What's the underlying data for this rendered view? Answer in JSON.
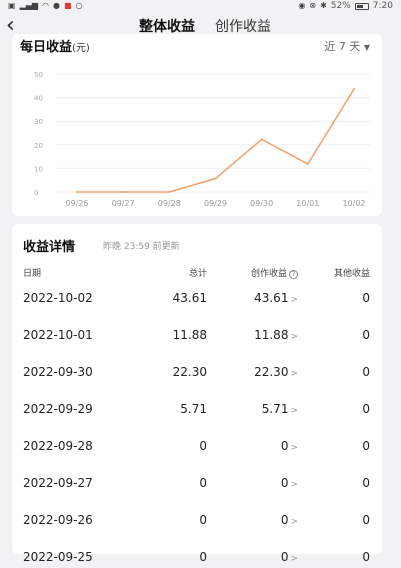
{
  "status_bar": {
    "battery_percent": "52%",
    "time": "7:20"
  },
  "header": {
    "tabs": [
      {
        "label": "整体收益",
        "active": true
      },
      {
        "label": "创作收益",
        "active": false
      }
    ]
  },
  "daily_card": {
    "title": "每日收益",
    "unit": "(元)",
    "range_label": "近 7 天"
  },
  "chart_data": {
    "type": "line",
    "categories": [
      "09/26",
      "09/27",
      "09/28",
      "09/29",
      "09/30",
      "10/01",
      "10/02"
    ],
    "values": [
      0,
      0,
      0,
      5.71,
      22.3,
      11.88,
      43.61
    ],
    "y_ticks": [
      0,
      10,
      20,
      30,
      40,
      50
    ],
    "ylim": [
      0,
      50
    ],
    "grid": true,
    "color": "#f0a26a"
  },
  "detail_card": {
    "title": "收益详情",
    "update_note": "昨晚 23:59 前更新",
    "columns": {
      "date": "日期",
      "total": "总计",
      "creation": "创作收益",
      "other": "其他收益"
    },
    "rows": [
      {
        "date": "2022-10-02",
        "total": "43.61",
        "creation": "43.61",
        "other": "0"
      },
      {
        "date": "2022-10-01",
        "total": "11.88",
        "creation": "11.88",
        "other": "0"
      },
      {
        "date": "2022-09-30",
        "total": "22.30",
        "creation": "22.30",
        "other": "0"
      },
      {
        "date": "2022-09-29",
        "total": "5.71",
        "creation": "5.71",
        "other": "0"
      },
      {
        "date": "2022-09-28",
        "total": "0",
        "creation": "0",
        "other": "0"
      },
      {
        "date": "2022-09-27",
        "total": "0",
        "creation": "0",
        "other": "0"
      },
      {
        "date": "2022-09-26",
        "total": "0",
        "creation": "0",
        "other": "0"
      },
      {
        "date": "2022-09-25",
        "total": "0",
        "creation": "0",
        "other": "0"
      }
    ]
  }
}
